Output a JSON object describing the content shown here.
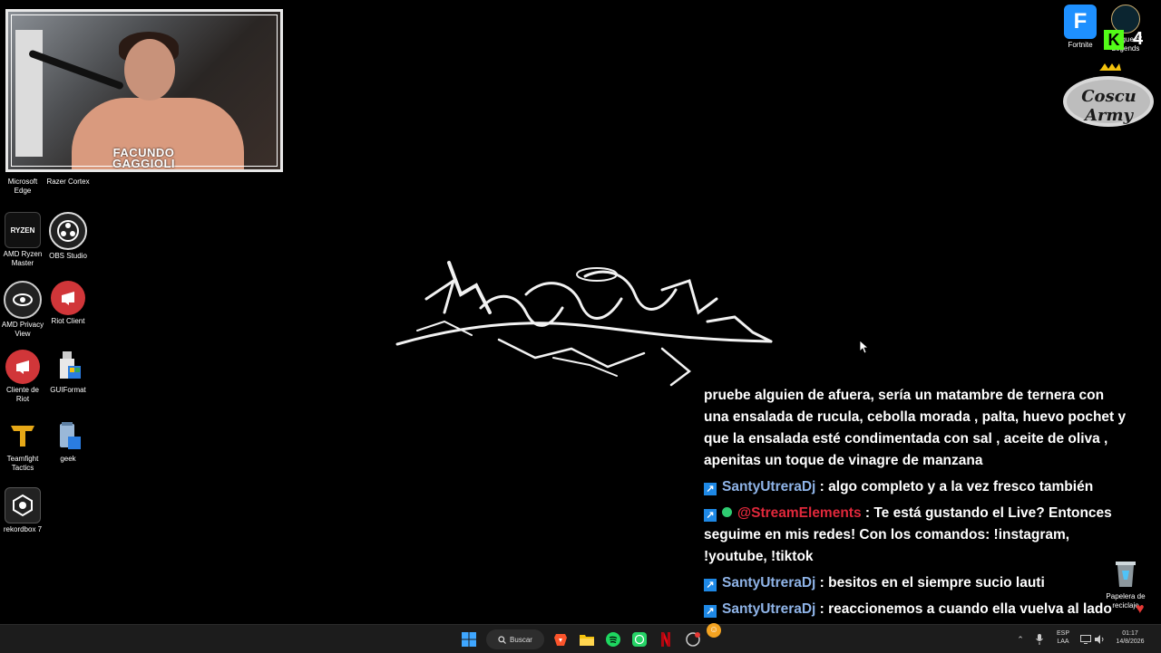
{
  "webcam": {
    "name_line1": "FACUNDO",
    "name_line2": "GAGGIOLI"
  },
  "desktop_icons": [
    {
      "label": "Microsoft Edge",
      "icon": "edge-icon"
    },
    {
      "label": "Razer Cortex",
      "icon": "razer-icon"
    },
    {
      "label": "AMD Ryzen Master",
      "icon": "ryzen-icon"
    },
    {
      "label": "OBS Studio",
      "icon": "obs-icon"
    },
    {
      "label": "AMD Privacy View",
      "icon": "privacy-icon"
    },
    {
      "label": "Riot Client",
      "icon": "riot-icon"
    },
    {
      "label": "Cliente de Riot",
      "icon": "riot-icon"
    },
    {
      "label": "GUIFormat",
      "icon": "usb-icon"
    },
    {
      "label": "Teamfight Tactics",
      "icon": "tft-icon"
    },
    {
      "label": "geek",
      "icon": "geek-icon"
    },
    {
      "label": "rekordbox 7",
      "icon": "rekordbox-icon"
    },
    {
      "label": "Fortnite",
      "icon": "fortnite-icon"
    },
    {
      "label": "League of Legends",
      "icon": "lol-icon"
    },
    {
      "label": "Papelera de reciclaje",
      "icon": "recycle-bin-icon"
    }
  ],
  "overlay": {
    "kick_number": "4",
    "ryzen_text": "RYZEN",
    "fortnite_letter": "F",
    "kick_letter": "K",
    "army_logo_text": "Coscu Army"
  },
  "chat": {
    "messages": [
      {
        "user": "",
        "text": "pruebe alguien de afuera, sería un matambre de ternera con una ensalada de rucula, cebolla morada , palta, huevo pochet y que la ensalada esté condimentada con sal , aceite de oliva , apenitas un toque de vinagre de manzana"
      },
      {
        "user": "SantyUtreraDj",
        "text": " : algo completo y a la vez fresco también"
      },
      {
        "user": "@StreamElements",
        "text": " : Te está gustando el Live? Entonces seguime en mis redes! Con los comandos: !instagram, !youtube, !tiktok"
      },
      {
        "user": "SantyUtreraDj",
        "text": " : besitos en el siempre sucio lauti"
      },
      {
        "user": "SantyUtreraDj",
        "text": " : reaccionemos a cuando ella vuelva al lado mio"
      }
    ]
  },
  "taskbar": {
    "search_label": "Buscar",
    "lang_line1": "ESP",
    "lang_line2": "LAA",
    "time": "01:17",
    "date": "14/8/2026"
  },
  "colors": {
    "chat_user": "#8fb4e8",
    "chat_user_bot": "#e0283b",
    "badge": "#1e88e5"
  }
}
